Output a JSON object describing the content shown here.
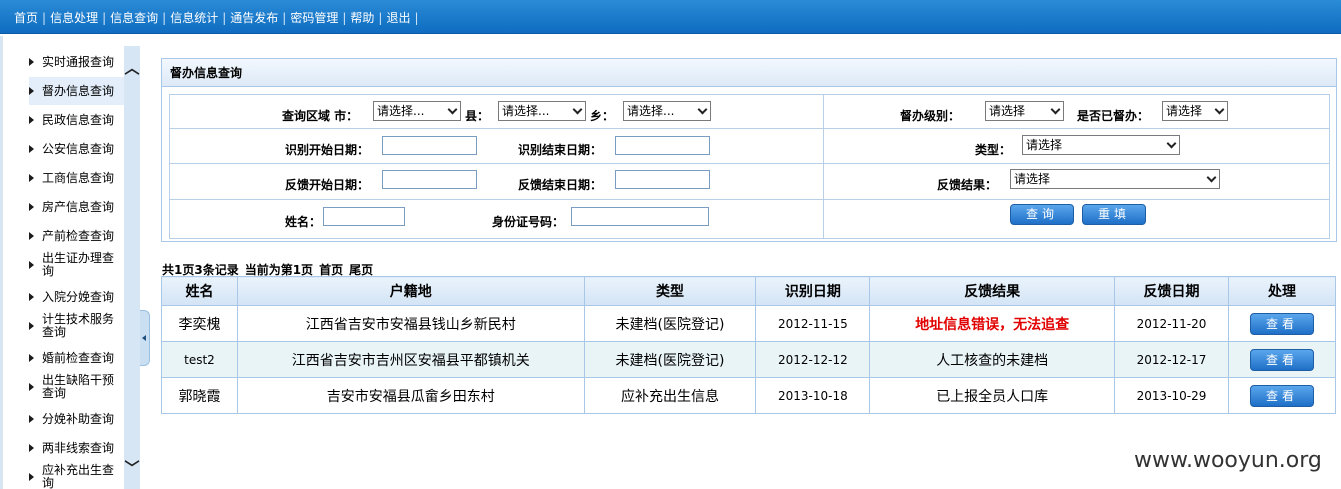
{
  "nav": {
    "items": [
      "首页",
      "信息处理",
      "信息查询",
      "信息统计",
      "通告发布",
      "密码管理",
      "帮助",
      "退出"
    ],
    "separator": "|"
  },
  "sidebar": {
    "items": [
      {
        "label": "实时通报查询"
      },
      {
        "label": "督办信息查询"
      },
      {
        "label": "民政信息查询"
      },
      {
        "label": "公安信息查询"
      },
      {
        "label": "工商信息查询"
      },
      {
        "label": "房产信息查询"
      },
      {
        "label": "产前检查查询"
      },
      {
        "label": "出生证办理查询"
      },
      {
        "label": "入院分娩查询"
      },
      {
        "label": "计生技术服务查询"
      },
      {
        "label": "婚前检查查询"
      },
      {
        "label": "出生缺陷干预查询"
      },
      {
        "label": "分娩补助查询"
      },
      {
        "label": "两非线索查询"
      },
      {
        "label": "应补充出生查询"
      }
    ],
    "scroll_up": "︿",
    "scroll_down": "﹀"
  },
  "query": {
    "title": "督办信息查询",
    "region_label": "查询区域 市：",
    "city_value": "请选择...",
    "county_label": "县：",
    "county_value": "请选择...",
    "town_label": "乡：",
    "town_value": "请选择...",
    "level_label": "督办级别：",
    "level_value": "请选择",
    "supervised_label": "是否已督办：",
    "supervised_value": "请选择",
    "id_start_label": "识别开始日期：",
    "id_end_label": "识别结束日期：",
    "type_label": "类型：",
    "type_value": "请选择",
    "fb_start_label": "反馈开始日期：",
    "fb_end_label": "反馈结束日期：",
    "fb_result_label": "反馈结果：",
    "fb_result_value": "请选择",
    "name_label": "姓名：",
    "idcard_label": "身份证号码：",
    "search_button": "查询",
    "reset_button": "重填"
  },
  "pager": {
    "summary": "共1页3条记录",
    "current": "当前为第1页",
    "first": "首页",
    "last": "尾页"
  },
  "table": {
    "headers": [
      "姓名",
      "户籍地",
      "类型",
      "识别日期",
      "反馈结果",
      "反馈日期",
      "处理"
    ],
    "rows": [
      {
        "name": "李奕槐",
        "address": "江西省吉安市安福县钱山乡新民村",
        "type": "未建档(医院登记)",
        "id_date": "2012-11-15",
        "result": "地址信息错误，无法追查",
        "fb_date": "2012-11-20",
        "action": "查看"
      },
      {
        "name": "test2",
        "address": "江西省吉安市吉州区安福县平都镇机关",
        "type": "未建档(医院登记)",
        "id_date": "2012-12-12",
        "result": "人工核查的未建档",
        "fb_date": "2012-12-17",
        "action": "查看"
      },
      {
        "name": "郭晓霞",
        "address": "吉安市安福县瓜畲乡田东村",
        "type": "应补充出生信息",
        "id_date": "2013-10-18",
        "result": "已上报全员人口库",
        "fb_date": "2013-10-29",
        "action": "查看"
      }
    ]
  },
  "watermark": "www.wooyun.org"
}
